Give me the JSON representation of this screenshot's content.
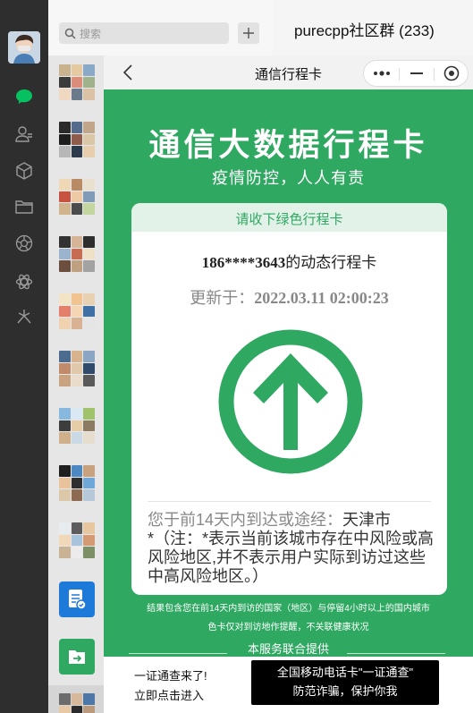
{
  "sidebar": {
    "avatar": "user-avatar",
    "icons": [
      "chat-bubble-icon",
      "contacts-icon",
      "cube-icon",
      "folder-icon",
      "shutter-icon",
      "mini-program-icon",
      "star-sparkle-icon"
    ],
    "active_color": "#07c160"
  },
  "search": {
    "placeholder": "搜索"
  },
  "chat_header": {
    "title": "purecpp社区群 (233)"
  },
  "mini_program": {
    "title": "通信行程卡",
    "capsule": {
      "more": "more-dots-icon",
      "minimize": "minimize-icon",
      "close": "close-target-icon"
    },
    "heading": "通信大数据行程卡",
    "subheading": "疫情防控，人人有责",
    "card": {
      "bar_text": "请收下绿色行程卡",
      "phone_number": "186****3643",
      "phone_suffix": "的动态行程卡",
      "updated_prefix": "更新于：",
      "updated_time": "2022.03.11 02:00:23",
      "status_icon": "green-up-arrow-icon",
      "route_prefix": "您于前14天内到达或途经：",
      "route_city": "天津市",
      "route_note": "*（注：*表示当前该城市存在中风险或高风险地区,并不表示用户实际到访过这些中高风险地区。）"
    },
    "footnote_1": "结果包含您在前14天内到访的国家（地区）与停留4小时以上的国内城市",
    "footnote_2": "色卡仅对到访地作提醒，不关联健康状况",
    "service": "本服务联合提供",
    "bottom": {
      "left_1": "一证通查来了!",
      "left_2": "立即点击进入",
      "right_1": "全国移动电话卡\"一证通查\"",
      "right_2": "防范诈骗，保护你我"
    },
    "accent_color": "#2fa862"
  }
}
